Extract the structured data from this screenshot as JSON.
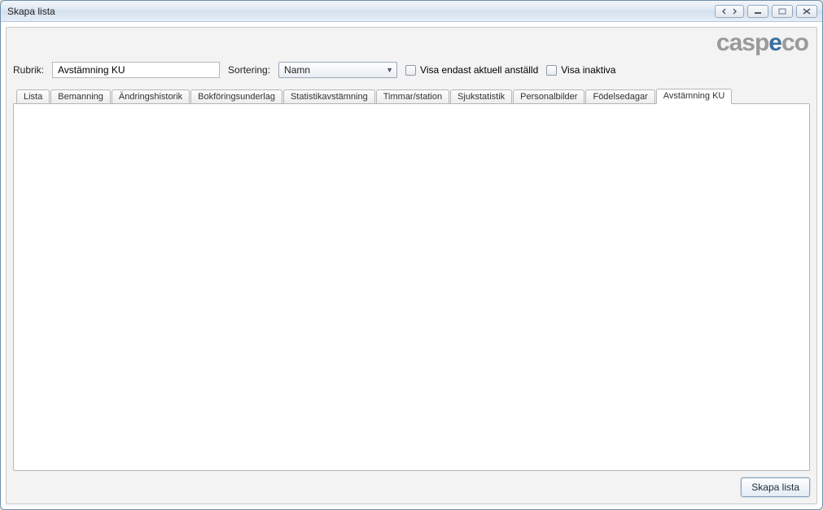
{
  "window": {
    "title": "Skapa lista"
  },
  "logo": {
    "textA": "casp",
    "textB": "e",
    "textC": "co"
  },
  "controls": {
    "rubrik_label": "Rubrik:",
    "rubrik_value": "Avstämning KU",
    "sortering_label": "Sortering:",
    "sortering_selected": "Namn",
    "checkbox1_label": "Visa endast aktuell anställd",
    "checkbox2_label": "Visa inaktiva"
  },
  "tabs": [
    {
      "label": "Lista"
    },
    {
      "label": "Bemanning"
    },
    {
      "label": "Ändringshistorik"
    },
    {
      "label": "Bokföringsunderlag"
    },
    {
      "label": "Statistikavstämning"
    },
    {
      "label": "Timmar/station"
    },
    {
      "label": "Sjukstatistik"
    },
    {
      "label": "Personalbilder"
    },
    {
      "label": "Födelsedagar"
    },
    {
      "label": "Avstämning KU"
    }
  ],
  "active_tab_index": 9,
  "footer": {
    "create_button": "Skapa lista"
  }
}
